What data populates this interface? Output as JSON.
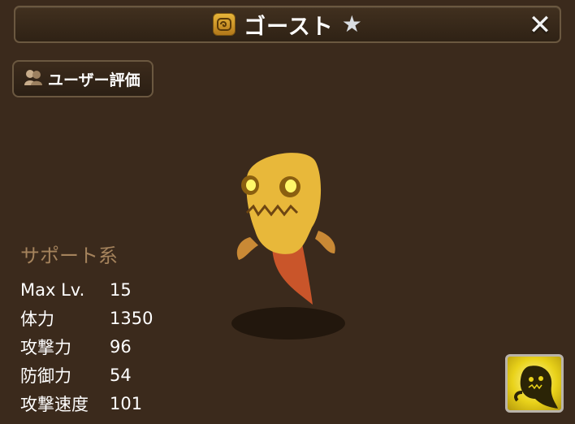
{
  "header": {
    "title": "ゴースト",
    "title_icon": "rune-scroll-icon",
    "grade_icon": "star-icon",
    "close_label": "✕"
  },
  "review_button": {
    "label": "ユーザー評価",
    "icon": "users-icon"
  },
  "monster": {
    "name": "ゴースト",
    "category": "サポート系",
    "body_color": "#e8b83a",
    "stats": [
      {
        "label": "Max Lv.",
        "value": "15"
      },
      {
        "label": "体力",
        "value": "1350"
      },
      {
        "label": "攻撃力",
        "value": "96"
      },
      {
        "label": "防御力",
        "value": "54"
      },
      {
        "label": "攻撃速度",
        "value": "101"
      }
    ]
  },
  "skill": {
    "icon": "ghost-skill-icon",
    "color": "#e9d21a"
  }
}
